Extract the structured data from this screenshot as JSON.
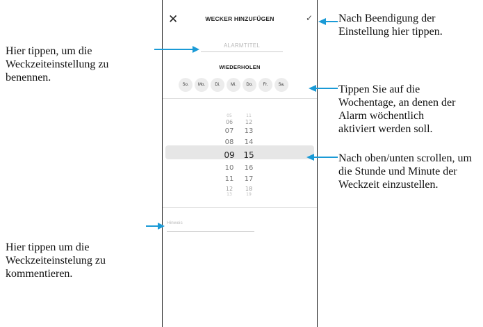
{
  "screen": {
    "header": {
      "close_icon": "close-icon",
      "close_glyph": "✕",
      "title": "WECKER HINZUFÜGEN",
      "confirm_icon": "check-icon",
      "confirm_glyph": "✓"
    },
    "alarm_title_placeholder": "ALARMTITEL",
    "repeat_label": "WIEDERHOLEN",
    "weekdays": [
      "So.",
      "Mo.",
      "Di.",
      "Mi.",
      "Do.",
      "Fr.",
      "Sa."
    ],
    "hours": [
      "05",
      "06",
      "07",
      "08",
      "09",
      "10",
      "11",
      "12",
      "13"
    ],
    "minutes": [
      "11",
      "12",
      "13",
      "14",
      "15",
      "16",
      "17",
      "18",
      "19"
    ],
    "selected_hour": "09",
    "selected_minute": "15",
    "note_placeholder": "Hinweis"
  },
  "annotations": {
    "title_hint": "Hier tippen, um die Weckzeiteinstellung zu benennen.",
    "note_hint": "Hier tippen um die Weckzeiteinstelung zu kommentieren.",
    "confirm_hint": "Nach Beendigung der Einstellung hier tippen.",
    "weekday_hint": "Tippen Sie auf die Wochentage, an denen der Alarm wöchentlich aktiviert werden soll.",
    "picker_hint": "Nach oben/unten scrollen, um die Stunde und Minute der Weckzeit einzustellen."
  },
  "colors": {
    "arrow": "#1a9ad6",
    "picker_band": "#e6e6e6",
    "day_chip": "#ececec"
  }
}
